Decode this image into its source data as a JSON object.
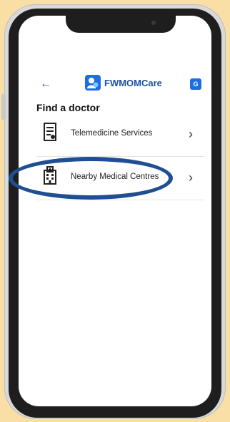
{
  "app": {
    "brand": "FWMOMCare",
    "icons": {
      "back": "arrow-left-icon",
      "logo": "fwmomcare-logo",
      "translate": "translate-icon"
    }
  },
  "page": {
    "title": "Find a doctor"
  },
  "items": [
    {
      "label": "Telemedicine Services",
      "icon": "document-icon"
    },
    {
      "label": "Nearby Medical Centres",
      "icon": "hospital-building-icon"
    }
  ],
  "colors": {
    "background": "#f9dfa6",
    "accent": "#1d6fe0",
    "brand_text": "#1d4fa3",
    "highlight": "#1f4f92"
  }
}
